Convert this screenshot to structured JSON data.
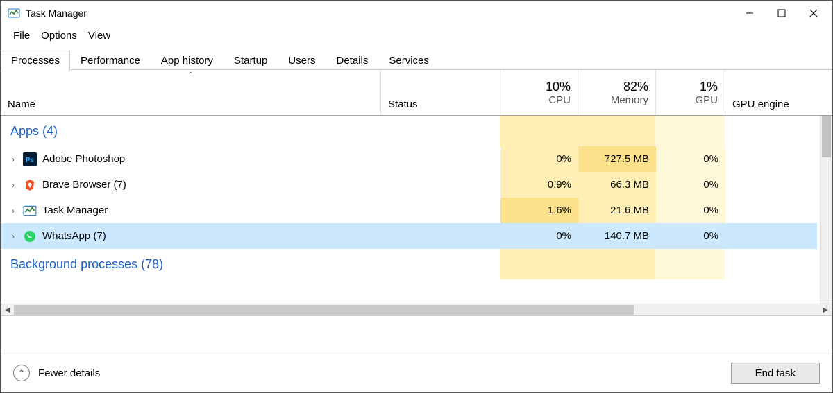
{
  "window": {
    "title": "Task Manager"
  },
  "menu": {
    "file": "File",
    "options": "Options",
    "view": "View"
  },
  "tabs": [
    {
      "label": "Processes",
      "active": true
    },
    {
      "label": "Performance"
    },
    {
      "label": "App history"
    },
    {
      "label": "Startup"
    },
    {
      "label": "Users"
    },
    {
      "label": "Details"
    },
    {
      "label": "Services"
    }
  ],
  "headers": {
    "name": "Name",
    "status": "Status",
    "cpu_pct": "10%",
    "cpu": "CPU",
    "mem_pct": "82%",
    "mem": "Memory",
    "gpu_pct": "1%",
    "gpu": "GPU",
    "gpu_engine": "GPU engine"
  },
  "groups": [
    {
      "title": "Apps (4)",
      "rows": [
        {
          "name": "Adobe Photoshop",
          "cpu": "0%",
          "mem": "727.5 MB",
          "gpu": "0%",
          "cpu_heat": 1,
          "mem_heat": 2,
          "gpu_heat": 0,
          "icon": "photoshop",
          "selected": false
        },
        {
          "name": "Brave Browser (7)",
          "cpu": "0.9%",
          "mem": "66.3 MB",
          "gpu": "0%",
          "cpu_heat": 1,
          "mem_heat": 1,
          "gpu_heat": 0,
          "icon": "brave",
          "selected": false
        },
        {
          "name": "Task Manager",
          "cpu": "1.6%",
          "mem": "21.6 MB",
          "gpu": "0%",
          "cpu_heat": 2,
          "mem_heat": 1,
          "gpu_heat": 0,
          "icon": "taskmgr",
          "selected": false
        },
        {
          "name": "WhatsApp (7)",
          "cpu": "0%",
          "mem": "140.7 MB",
          "gpu": "0%",
          "cpu_heat": 0,
          "mem_heat": 0,
          "gpu_heat": 0,
          "icon": "whatsapp",
          "selected": true
        }
      ]
    },
    {
      "title": "Background processes (78)",
      "rows": []
    }
  ],
  "footer": {
    "fewer": "Fewer details",
    "end": "End task"
  }
}
